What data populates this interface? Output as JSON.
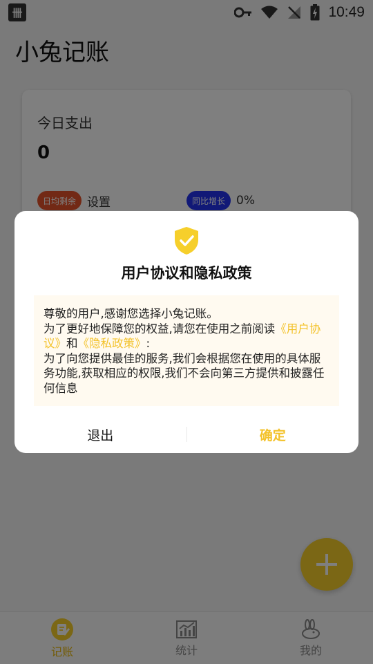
{
  "status_bar": {
    "time": "10:49",
    "app_icon_text": "卌"
  },
  "header": {
    "title": "小兔记账"
  },
  "summary": {
    "label": "今日支出",
    "amount": "0",
    "daily_badge": "日均剩余",
    "daily_value": "设置",
    "yoy_badge": "同比增长",
    "yoy_value": "0%"
  },
  "dialog": {
    "title": "用户协议和隐私政策",
    "line1": "尊敬的用户,感谢您选择小兔记账。",
    "line2_prefix": "为了更好地保障您的权益,请您在使用之前阅读",
    "user_agreement_link": "《用户协议》",
    "and_text": "和",
    "privacy_link": "《隐私政策》",
    "colon": ":",
    "line3": "为了向您提供最佳的服务,我们会根据您在使用的具体服务功能,获取相应的权限,我们不会向第三方提供和披露任何信息",
    "exit_label": "退出",
    "confirm_label": "确定"
  },
  "bottom_nav": {
    "items": [
      {
        "label": "记账",
        "icon": "bookkeeping-icon",
        "active": true
      },
      {
        "label": "统计",
        "icon": "chart-icon",
        "active": false
      },
      {
        "label": "我的",
        "icon": "rabbit-icon",
        "active": false
      }
    ]
  },
  "colors": {
    "accent": "#f6cf2b",
    "link": "#f3c22a",
    "orange_badge": "#e5532a",
    "blue_badge": "#2233ee"
  }
}
